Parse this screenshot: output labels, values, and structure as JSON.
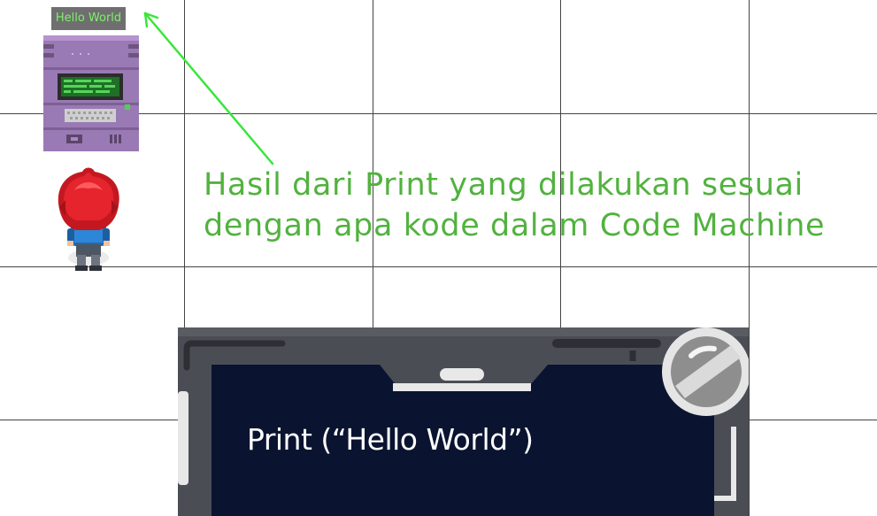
{
  "game": {
    "print_output": "Hello World",
    "annotation_line1": "Hasil dari Print yang dilakukan sesuai",
    "annotation_line2": "dengan apa kode dalam Code Machine"
  },
  "code_panel": {
    "code": "Print (“Hello World”)"
  },
  "colors": {
    "grid_line": "#444444",
    "annotation_text": "#52b23f",
    "arrow": "#39e63a",
    "bubble_bg": "#6f6f6f",
    "bubble_text": "#7ef06a",
    "panel_screen": "#0a1430",
    "panel_frame": "#4b4d55"
  },
  "icons": {
    "machine": "code-machine-icon",
    "player": "player-character-icon",
    "close": "close-orb-icon"
  }
}
